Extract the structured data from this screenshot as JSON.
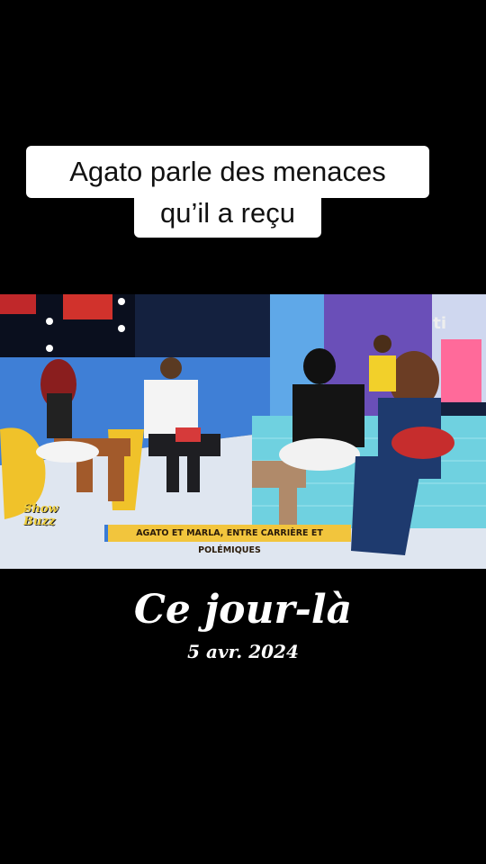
{
  "caption": {
    "line1": "Agato parle des menaces",
    "line2": "qu’il a reçu"
  },
  "video": {
    "lower_third": "AGATO ET MARLA, ENTRE CARRIÈRE ET POLÉMIQUES",
    "show_logo": "Show Buzz",
    "channel_mark": "ti"
  },
  "memory": {
    "title": "Ce jour-là",
    "date": "5 avr. 2024"
  }
}
